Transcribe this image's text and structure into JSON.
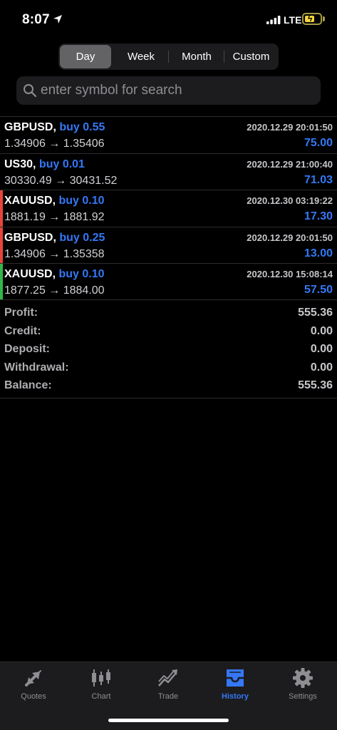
{
  "status_bar": {
    "time": "8:07",
    "network": "LTE"
  },
  "period_tabs": [
    {
      "label": "Day",
      "active": true
    },
    {
      "label": "Week",
      "active": false
    },
    {
      "label": "Month",
      "active": false
    },
    {
      "label": "Custom",
      "active": false
    }
  ],
  "search": {
    "placeholder": "enter symbol for search",
    "value": ""
  },
  "trades": [
    {
      "symbol": "GBPUSD,",
      "side": "buy 0.55",
      "datetime": "2020.12.29 20:01:50",
      "prices": "1.34906 → 1.35406",
      "profit": "75.00",
      "marker_color": ""
    },
    {
      "symbol": "US30,",
      "side": "buy 0.01",
      "datetime": "2020.12.29 21:00:40",
      "prices": "30330.49 → 30431.52",
      "profit": "71.03",
      "marker_color": ""
    },
    {
      "symbol": "XAUUSD,",
      "side": "buy 0.10",
      "datetime": "2020.12.30 03:19:22",
      "prices": "1881.19 → 1881.92",
      "profit": "17.30",
      "marker_color": "#e5453a"
    },
    {
      "symbol": "GBPUSD,",
      "side": "buy 0.25",
      "datetime": "2020.12.29 20:01:50",
      "prices": "1.34906 → 1.35358",
      "profit": "13.00",
      "marker_color": "#e5453a"
    },
    {
      "symbol": "XAUUSD,",
      "side": "buy 0.10",
      "datetime": "2020.12.30 15:08:14",
      "prices": "1877.25 → 1884.00",
      "profit": "57.50",
      "marker_color": "#2fb84a"
    }
  ],
  "summary": [
    {
      "label": "Profit:",
      "value": "555.36"
    },
    {
      "label": "Credit:",
      "value": "0.00"
    },
    {
      "label": "Deposit:",
      "value": "0.00"
    },
    {
      "label": "Withdrawal:",
      "value": "0.00"
    },
    {
      "label": "Balance:",
      "value": "555.36"
    }
  ],
  "tab_bar": [
    {
      "label": "Quotes",
      "icon": "quotes-icon",
      "active": false
    },
    {
      "label": "Chart",
      "icon": "chart-icon",
      "active": false
    },
    {
      "label": "Trade",
      "icon": "trade-icon",
      "active": false
    },
    {
      "label": "History",
      "icon": "history-icon",
      "active": true
    },
    {
      "label": "Settings",
      "icon": "settings-icon",
      "active": false
    }
  ],
  "colors": {
    "accent": "#3478f6",
    "loss_marker": "#e5453a",
    "gain_marker": "#2fb84a"
  }
}
